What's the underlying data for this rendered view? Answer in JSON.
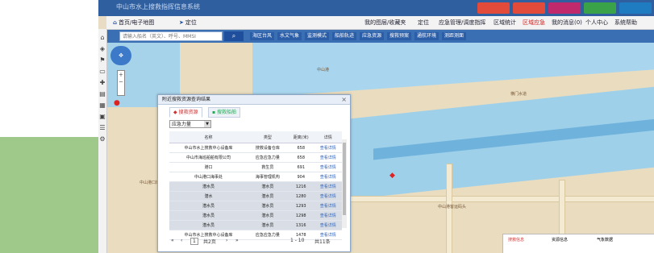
{
  "app": {
    "title": "中山市水上搜救指挥信息系统",
    "window_buttons": [
      "#e24a3a",
      "#e24a3a",
      "#c0296c",
      "#3aa34a",
      "#1f7cc0"
    ]
  },
  "nav": {
    "home": "首页/电子地图",
    "mark": "定位",
    "right_items": [
      "我的图层/收藏夹",
      "定位",
      "应急管理/调度指挥",
      "区域统计",
      "区域应急",
      "我的消息(0)",
      "个人中心",
      "系统帮助"
    ]
  },
  "toolbar": {
    "search_placeholder": "请输入船名（英文）、呼号、MMSI",
    "search_icon": "search-icon",
    "items": [
      "海区台风",
      "水文气象",
      "监测模式",
      "船舶轨迹",
      "应急资源",
      "搜救预案",
      "通航环境",
      "测距测面"
    ]
  },
  "sidebar": {
    "icons": [
      "home-icon",
      "layers-icon",
      "flag-icon",
      "ship-icon",
      "rescue-icon",
      "chart-icon",
      "calendar-icon",
      "monitor-icon",
      "list-icon",
      "settings-icon"
    ]
  },
  "dialog": {
    "title": "附近搜救资源查询结果",
    "tabs": [
      "搜救资源",
      "搜救船舶"
    ],
    "filter_value": "应急力量",
    "columns": [
      "名称",
      "类型",
      "距离(米)",
      "详情"
    ],
    "rows": [
      {
        "name": "中山市水上搜救中心设备库",
        "type": "搜救设备仓库",
        "dist": "658",
        "link": "查看详情",
        "shade": false
      },
      {
        "name": "中山市海巡船舶有限公司",
        "type": "应急应急力量",
        "dist": "658",
        "link": "查看详情",
        "shade": false
      },
      {
        "name": "港口",
        "type": "救生员",
        "dist": "691",
        "link": "查看详情",
        "shade": false
      },
      {
        "name": "中山港口海事处",
        "type": "海事管理机构",
        "dist": "904",
        "link": "查看详情",
        "shade": false
      },
      {
        "name": "潜水员",
        "type": "潜水员",
        "dist": "1216",
        "link": "查看详情",
        "shade": true
      },
      {
        "name": "潜水",
        "type": "潜水员",
        "dist": "1280",
        "link": "查看详情",
        "shade": true
      },
      {
        "name": "潜水员",
        "type": "潜水员",
        "dist": "1293",
        "link": "查看详情",
        "shade": true
      },
      {
        "name": "潜水员",
        "type": "潜水员",
        "dist": "1298",
        "link": "查看详情",
        "shade": true
      },
      {
        "name": "潜水员",
        "type": "潜水员",
        "dist": "1316",
        "link": "查看详情",
        "shade": true
      },
      {
        "name": "中山市水上搜救中心设备库",
        "type": "应急应急力量",
        "dist": "1478",
        "link": "查看详情",
        "shade": false
      }
    ],
    "pager": {
      "page": "1",
      "total_pages": "共2页",
      "range": "1 - 10",
      "total": "共11条"
    }
  },
  "map": {
    "labels": [
      "中山港",
      "横门水道",
      "中山港客运码头",
      "中山港口岸"
    ],
    "bottom_tabs": [
      "搜救信息",
      "资源信息",
      "气象数据"
    ]
  }
}
